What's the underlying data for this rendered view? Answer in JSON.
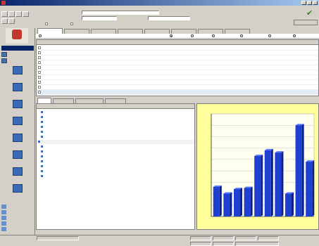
{
  "window": {
    "title": ""
  },
  "menu": [
    "",
    "",
    "",
    ""
  ],
  "toolbar": {
    "buttons": [
      "folder-icon",
      "save-icon",
      "print-icon",
      "refresh-icon",
      "filter-icon",
      "export-icon"
    ]
  },
  "filter_panel": {
    "fields": [
      {
        "label": "",
        "value": ""
      },
      {
        "label": "",
        "value": ""
      },
      {
        "label": "",
        "value": ""
      }
    ],
    "checks": [
      "",
      "",
      "",
      ""
    ],
    "apply_button": ""
  },
  "sidebar": {
    "logo_text": "",
    "logo_sub": "",
    "head_label": "",
    "items": [
      "",
      ""
    ],
    "big_items": [
      "",
      "",
      "",
      "",
      "",
      "",
      "",
      "",
      "",
      ""
    ],
    "bottom_items": [
      "",
      "",
      "",
      "",
      ""
    ]
  },
  "main_tabs": [
    "",
    "",
    "",
    "",
    "",
    "",
    "",
    ""
  ],
  "radio_options": [
    "",
    "",
    "",
    "",
    "",
    "",
    ""
  ],
  "top_table": {
    "columns": [
      "",
      "",
      "",
      "",
      "",
      "",
      "",
      "",
      "",
      "",
      "",
      "",
      ""
    ],
    "rows": [
      [
        "",
        "",
        "",
        "",
        "",
        "",
        "",
        "",
        "",
        "",
        "",
        "",
        ""
      ],
      [
        "",
        "",
        "",
        "",
        "",
        "",
        "",
        "",
        "",
        "",
        "",
        "",
        ""
      ],
      [
        "",
        "",
        "",
        "",
        "",
        "",
        "",
        "",
        "",
        "",
        "",
        "",
        ""
      ],
      [
        "",
        "",
        "",
        "",
        "",
        "",
        "",
        "",
        "",
        "",
        "",
        "",
        ""
      ],
      [
        "",
        "",
        "",
        "",
        "",
        "",
        "",
        "",
        "",
        "",
        "",
        "",
        ""
      ],
      [
        "",
        "",
        "",
        "",
        "",
        "",
        "",
        "",
        "",
        "",
        "",
        "",
        ""
      ],
      [
        "",
        "",
        "",
        "",
        "",
        "",
        "",
        "",
        "",
        "",
        "",
        "",
        ""
      ],
      [
        "",
        "",
        "",
        "",
        "",
        "",
        "",
        "",
        "",
        "",
        "",
        "",
        ""
      ],
      [
        "",
        "",
        "",
        "",
        "",
        "",
        "",
        "",
        "",
        "",
        "",
        "",
        ""
      ]
    ],
    "total_row": [
      "",
      "",
      "",
      "",
      "",
      "",
      "",
      "",
      "",
      "",
      "",
      "",
      ""
    ]
  },
  "lower_tabs": [
    "",
    "",
    "",
    ""
  ],
  "lower_title": "",
  "prop_grid": {
    "columns": [
      "",
      "",
      ""
    ],
    "rows": [
      {
        "label": "",
        "v1": "",
        "v2": "",
        "type": "item"
      },
      {
        "label": "",
        "v1": "",
        "v2": "",
        "type": "item"
      },
      {
        "label": "",
        "v1": "",
        "v2": "",
        "type": "item"
      },
      {
        "label": "",
        "v1": "",
        "v2": "",
        "type": "item"
      },
      {
        "label": "",
        "v1": "",
        "v2": "",
        "type": "item"
      },
      {
        "label": "",
        "v1": "",
        "v2": "",
        "type": "item"
      },
      {
        "label": "",
        "v1": "",
        "v2": "",
        "type": "section"
      },
      {
        "label": "",
        "v1": "",
        "v2": "",
        "type": "item"
      },
      {
        "label": "",
        "v1": "",
        "v2": "",
        "type": "item"
      },
      {
        "label": "",
        "v1": "",
        "v2": "",
        "type": "item"
      },
      {
        "label": "",
        "v1": "",
        "v2": "",
        "type": "item"
      },
      {
        "label": "",
        "v1": "",
        "v2": "",
        "type": "item"
      },
      {
        "label": "",
        "v1": "",
        "v2": "",
        "type": "item"
      },
      {
        "label": "",
        "v1": "",
        "v2": "",
        "type": "item"
      }
    ]
  },
  "chart_data": {
    "type": "bar",
    "title": "",
    "xlabel": "",
    "ylabel": "",
    "categories": [
      "",
      "",
      "",
      "",
      "",
      "",
      "",
      "",
      "",
      ""
    ],
    "values": [
      26,
      20,
      24,
      25,
      53,
      58,
      56,
      20,
      80,
      48
    ],
    "ylim": [
      0,
      90
    ],
    "yticks": [
      "",
      "",
      "",
      "",
      "",
      "",
      "",
      "",
      "",
      ""
    ],
    "bar_color": "#1f3fd0",
    "background": "#ffff9c",
    "grid": true
  },
  "status": {
    "fields": [
      "",
      "",
      "",
      "",
      "",
      "",
      "",
      ""
    ],
    "link": ""
  }
}
